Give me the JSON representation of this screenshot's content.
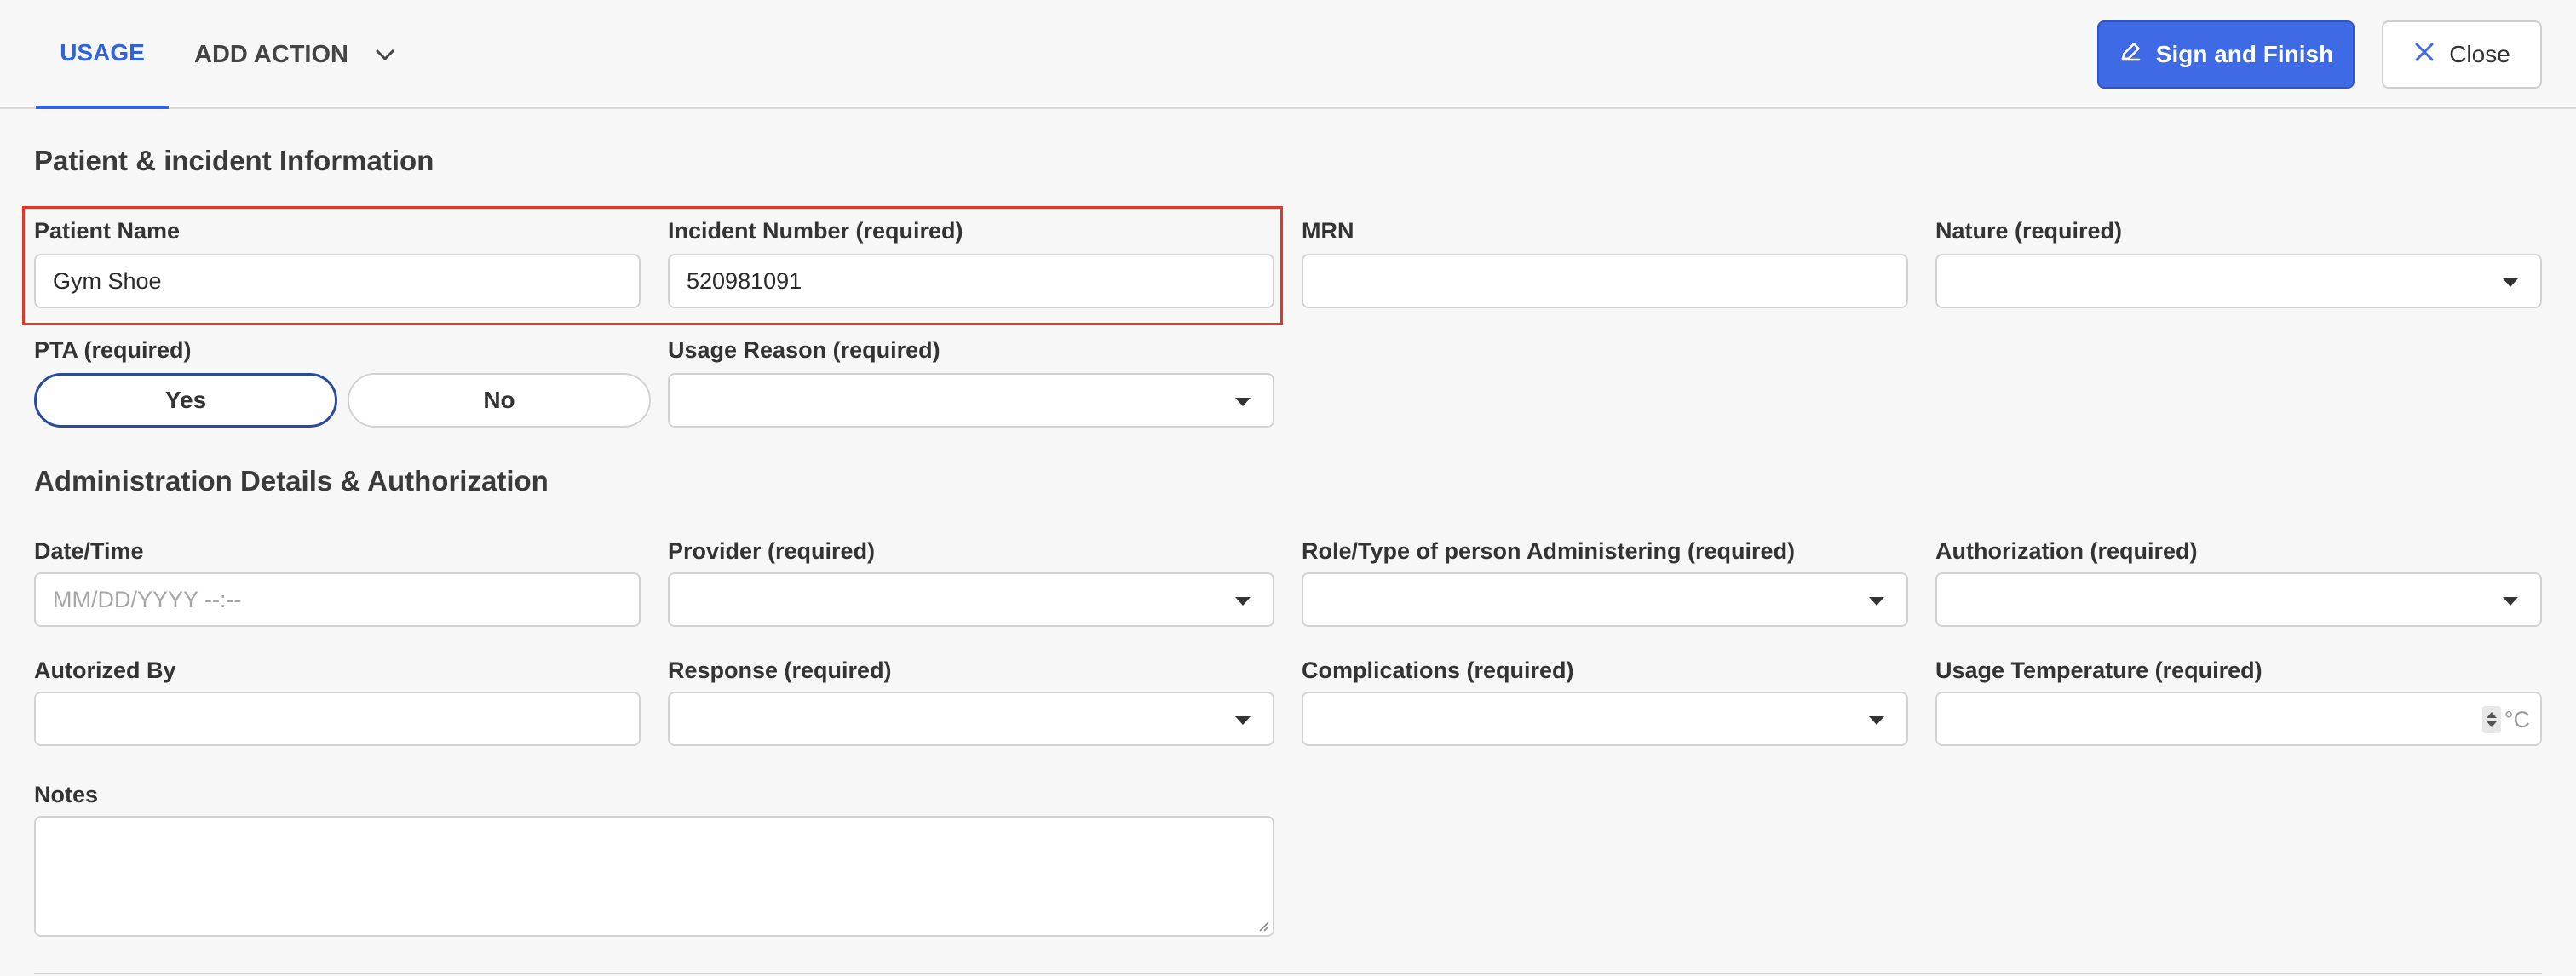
{
  "toolbar": {
    "tab_usage": "USAGE",
    "tab_add_action": "ADD ACTION",
    "sign_button": "Sign and Finish",
    "close_button": "Close"
  },
  "sections": {
    "patient": "Patient & incident Information",
    "admin": "Administration Details & Authorization"
  },
  "patient": {
    "name_label": "Patient Name",
    "name_value": "Gym Shoe",
    "incident_label": "Incident Number (required)",
    "incident_value": "520981091",
    "mrn_label": "MRN",
    "mrn_value": "",
    "nature_label": "Nature (required)",
    "pta_label": "PTA (required)",
    "pta_yes": "Yes",
    "pta_no": "No",
    "usage_reason_label": "Usage Reason (required)"
  },
  "admin": {
    "datetime_label": "Date/Time",
    "datetime_placeholder": "MM/DD/YYYY --:--",
    "provider_label": "Provider (required)",
    "role_label": "Role/Type of person Administering (required)",
    "authorization_label": "Authorization (required)",
    "authorized_by_label": "Autorized By",
    "response_label": "Response (required)",
    "complications_label": "Complications (required)",
    "temperature_label": "Usage Temperature (required)",
    "temperature_unit": "°C",
    "notes_label": "Notes"
  },
  "colors": {
    "accent": "#3e6ae6",
    "highlight": "#e0392b",
    "toggle_selected_border": "#2a4aa0"
  },
  "icons": {
    "sign": "pencil-icon",
    "close": "close-icon",
    "add_action_toggle": "chevron-down-icon"
  }
}
